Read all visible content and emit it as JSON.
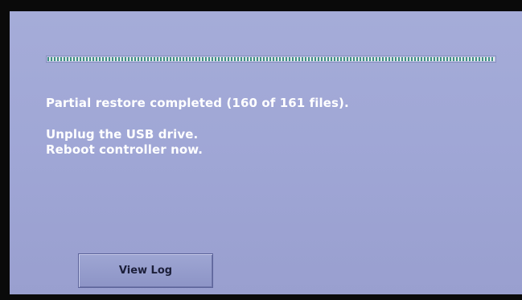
{
  "progress": {
    "fraction": 1.0
  },
  "messages": {
    "status": "Partial restore completed (160 of 161 files).",
    "instruction_1": "Unplug the USB drive.",
    "instruction_2": "Reboot controller now."
  },
  "buttons": {
    "view_log": "View Log"
  },
  "colors": {
    "screen_background": "#a0a7d6",
    "progress_stripe": "#3f8f86",
    "text": "#ffffff"
  }
}
